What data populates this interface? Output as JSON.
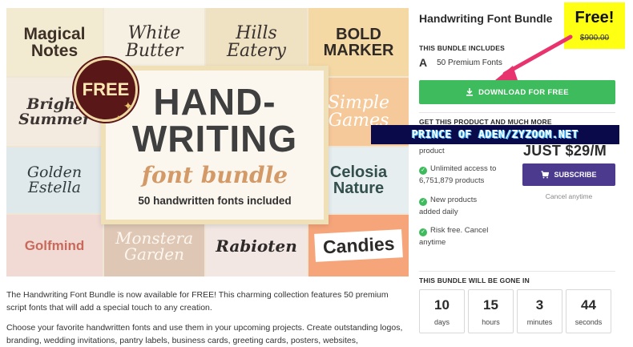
{
  "banner": {
    "tiles": {
      "t1": "Magical Notes",
      "t2": "White Butter",
      "t3": "Hills Eatery",
      "t4": "BOLD MARKER",
      "t5": "Bright Summer",
      "t6": "Simple Games",
      "t7": "Golden Estella",
      "t8": "Celosia Nature",
      "t9": "Golfmind",
      "t10": "Monstera Garden",
      "t11": "Rabioten",
      "t12": "Candies"
    },
    "badge": "FREE",
    "headline_line1": "HAND-",
    "headline_line2": "WRITING",
    "headline_script": "font bundle",
    "headline_sub": "50 handwritten fonts included"
  },
  "description": {
    "p1": "The Handwriting Font Bundle is now available for FREE! This charming collection features 50 premium script fonts that will add a special touch to any creation.",
    "p2": "Choose your favorite handwritten fonts and use them in your upcoming projects. Create outstanding logos, branding, wedding invitations, pantry labels, business cards, greeting cards, posters, websites,"
  },
  "panel": {
    "title": "Handwriting Font Bundle",
    "free_label": "Free!",
    "old_price": "$900.00",
    "includes_label": "THIS BUNDLE INCLUDES",
    "includes_icon": "A",
    "includes_text": "50 Premium Fonts",
    "download_label": "DOWNLOAD FOR FREE",
    "get_label": "GET THIS PRODUCT AND MUCH MORE",
    "ticker_text": "PRINCE OF ADEN/ZYZOOM.NET",
    "features": [
      {
        "text": "product"
      },
      {
        "line1": "Unlimited access to",
        "line2": "6,751,879 products"
      },
      {
        "line1": "New products",
        "line2": "added daily"
      },
      {
        "line1": "Risk free. Cancel",
        "line2": "anytime"
      }
    ],
    "price": "JUST $29/M",
    "subscribe_label": "SUBSCRIBE",
    "cancel_text": "Cancel anytime",
    "gone_label": "THIS BUNDLE WILL BE GONE IN",
    "countdown": [
      {
        "value": "10",
        "unit": "days"
      },
      {
        "value": "15",
        "unit": "hours"
      },
      {
        "value": "3",
        "unit": "minutes"
      },
      {
        "value": "44",
        "unit": "seconds"
      }
    ]
  },
  "colors": {
    "download_green": "#3dbb5d",
    "subscribe_purple": "#4b3a8e",
    "highlight_yellow": "#ffff14",
    "arrow_pink": "#e8336e"
  }
}
